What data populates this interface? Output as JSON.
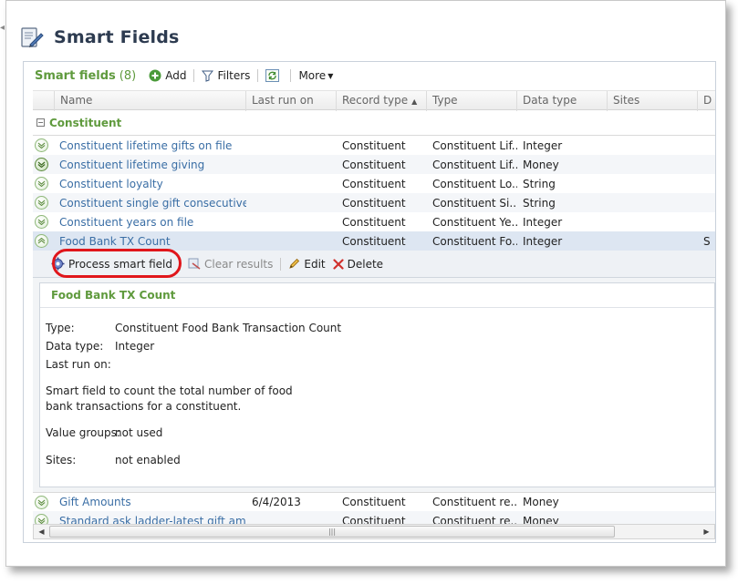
{
  "page": {
    "title": "Smart Fields"
  },
  "toolbar": {
    "title": "Smart fields",
    "count": "(8)",
    "add_label": "Add",
    "filters_label": "Filters",
    "more_label": "More"
  },
  "grid": {
    "columns": {
      "name": "Name",
      "last_run": "Last run on",
      "record_type": "Record type",
      "type": "Type",
      "data_type": "Data type",
      "sites": "Sites",
      "extra": "D"
    },
    "group": {
      "label": "Constituent",
      "toggle": "−"
    },
    "rows": [
      {
        "name": "Constituent lifetime gifts on file",
        "last_run": "",
        "record_type": "Constituent",
        "type": "Constituent Lif...",
        "data_type": "Integer",
        "sites": ""
      },
      {
        "name": "Constituent lifetime giving",
        "last_run": "",
        "record_type": "Constituent",
        "type": "Constituent Lif...",
        "data_type": "Money",
        "sites": ""
      },
      {
        "name": "Constituent loyalty",
        "last_run": "",
        "record_type": "Constituent",
        "type": "Constituent Lo...",
        "data_type": "String",
        "sites": ""
      },
      {
        "name": "Constituent single gift consecutive ...",
        "last_run": "",
        "record_type": "Constituent",
        "type": "Constituent Si...",
        "data_type": "String",
        "sites": ""
      },
      {
        "name": "Constituent years on file",
        "last_run": "",
        "record_type": "Constituent",
        "type": "Constituent Ye...",
        "data_type": "Integer",
        "sites": ""
      },
      {
        "name": "Food Bank TX Count",
        "last_run": "",
        "record_type": "Constituent",
        "type": "Constituent Fo...",
        "data_type": "Integer",
        "sites": "",
        "extra": "S"
      }
    ],
    "rows_after": [
      {
        "name": "Gift Amounts",
        "last_run": "6/4/2013",
        "record_type": "Constituent",
        "type": "Constituent re...",
        "data_type": "Money",
        "sites": ""
      },
      {
        "name": "Standard ask ladder-latest gift amou...",
        "last_run": "",
        "record_type": "Constituent",
        "type": "Constituent re...",
        "data_type": "Money",
        "sites": ""
      }
    ]
  },
  "actions": {
    "process_label": "Process smart field",
    "clear_label": "Clear results",
    "edit_label": "Edit",
    "delete_label": "Delete"
  },
  "detail": {
    "title": "Food Bank TX Count",
    "type_label": "Type:",
    "type_value": "Constituent Food Bank Transaction Count",
    "data_type_label": "Data type:",
    "data_type_value": "Integer",
    "last_run_label": "Last run on:",
    "last_run_value": "",
    "description": "Smart field to count the total number of food bank transactions for a constituent.",
    "value_groups_label": "Value groups:",
    "value_groups_value": "not used",
    "sites_label": "Sites:",
    "sites_value": "not enabled"
  },
  "scrollbar": {
    "left_arrow": "◀",
    "right_arrow": "▶",
    "grip": "|||"
  },
  "colors": {
    "green_accent": "#5f9a3d",
    "link_blue": "#3a6ea5",
    "highlight_red": "#e0161b",
    "title_navy": "#2d3b50"
  }
}
